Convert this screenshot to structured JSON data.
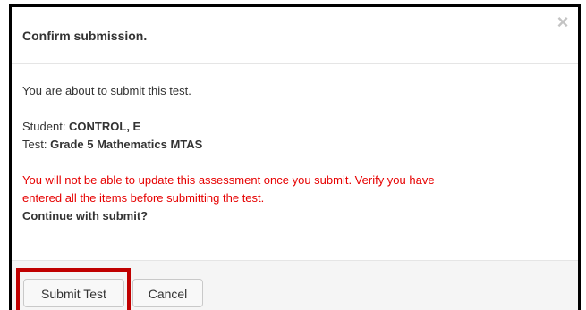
{
  "dialog": {
    "title": "Confirm submission.",
    "close_icon": "×",
    "body": {
      "intro": "You are about to submit this test.",
      "student_label": "Student: ",
      "student_value": "CONTROL, E",
      "test_label": "Test: ",
      "test_value": "Grade 5 Mathematics MTAS",
      "warning_line1": "You will not be able to update this assessment once you submit. Verify you have",
      "warning_line2": "entered all the items before submitting the test.",
      "prompt": "Continue with submit?"
    },
    "buttons": {
      "submit_label": "Submit Test",
      "cancel_label": "Cancel"
    }
  },
  "colors": {
    "warning_text": "#e60000",
    "highlight_border": "#c00000",
    "dialog_border": "#000000",
    "footer_background": "#f5f5f5"
  }
}
